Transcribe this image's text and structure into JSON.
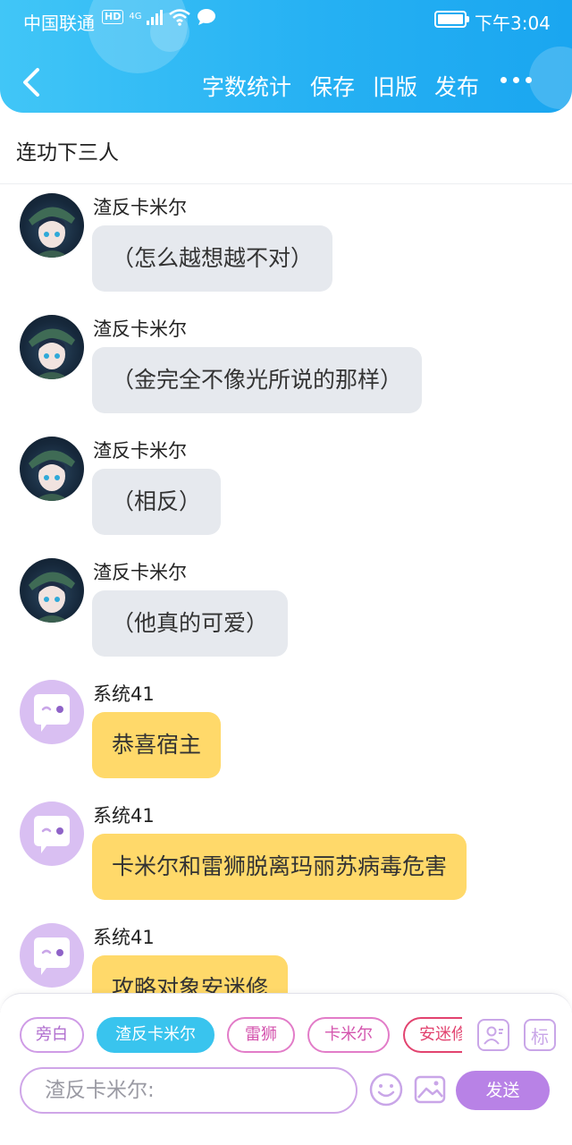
{
  "status_bar": {
    "carrier": "中国联通",
    "hd": "HD",
    "network": "4G",
    "time": "下午3:04"
  },
  "nav": {
    "word_count": "字数统计",
    "save": "保存",
    "old_version": "旧版",
    "publish": "发布"
  },
  "story_title": "连功下三人",
  "messages": [
    {
      "sender": "渣反卡米尔",
      "text": "（怎么越想越不对）",
      "avatar": "character-avatar",
      "bubble_color": "#e6e9ee"
    },
    {
      "sender": "渣反卡米尔",
      "text": "（金完全不像光所说的那样）",
      "avatar": "character-avatar",
      "bubble_color": "#e6e9ee"
    },
    {
      "sender": "渣反卡米尔",
      "text": "（相反）",
      "avatar": "character-avatar",
      "bubble_color": "#e6e9ee"
    },
    {
      "sender": "渣反卡米尔",
      "text": "（他真的可爱）",
      "avatar": "character-avatar",
      "bubble_color": "#e6e9ee"
    },
    {
      "sender": "系统41",
      "text": "恭喜宿主",
      "avatar": "system-chat-avatar",
      "bubble_color": "#ffd96a"
    },
    {
      "sender": "系统41",
      "text": "卡米尔和雷狮脱离玛丽苏病毒危害",
      "avatar": "system-chat-avatar",
      "bubble_color": "#ffd96a"
    },
    {
      "sender": "系统41",
      "text": "攻略对象安迷修",
      "avatar": "system-chat-avatar",
      "bubble_color": "#ffd96a"
    }
  ],
  "roles": [
    {
      "label": "旁白",
      "active": false
    },
    {
      "label": "渣反卡米尔",
      "active": true
    },
    {
      "label": "雷狮",
      "active": false
    },
    {
      "label": "卡米尔",
      "active": false
    },
    {
      "label": "安迷修",
      "active": false
    }
  ],
  "mark_label": "标",
  "input": {
    "placeholder": "渣反卡米尔:"
  },
  "send_label": "发送",
  "colors": {
    "header_gradient_start": "#41c6f7",
    "header_gradient_end": "#1aa6f0",
    "active_role": "#39c4ee",
    "send_button": "#b882e6",
    "system_bubble": "#ffd96a",
    "character_bubble": "#e6e9ee"
  }
}
